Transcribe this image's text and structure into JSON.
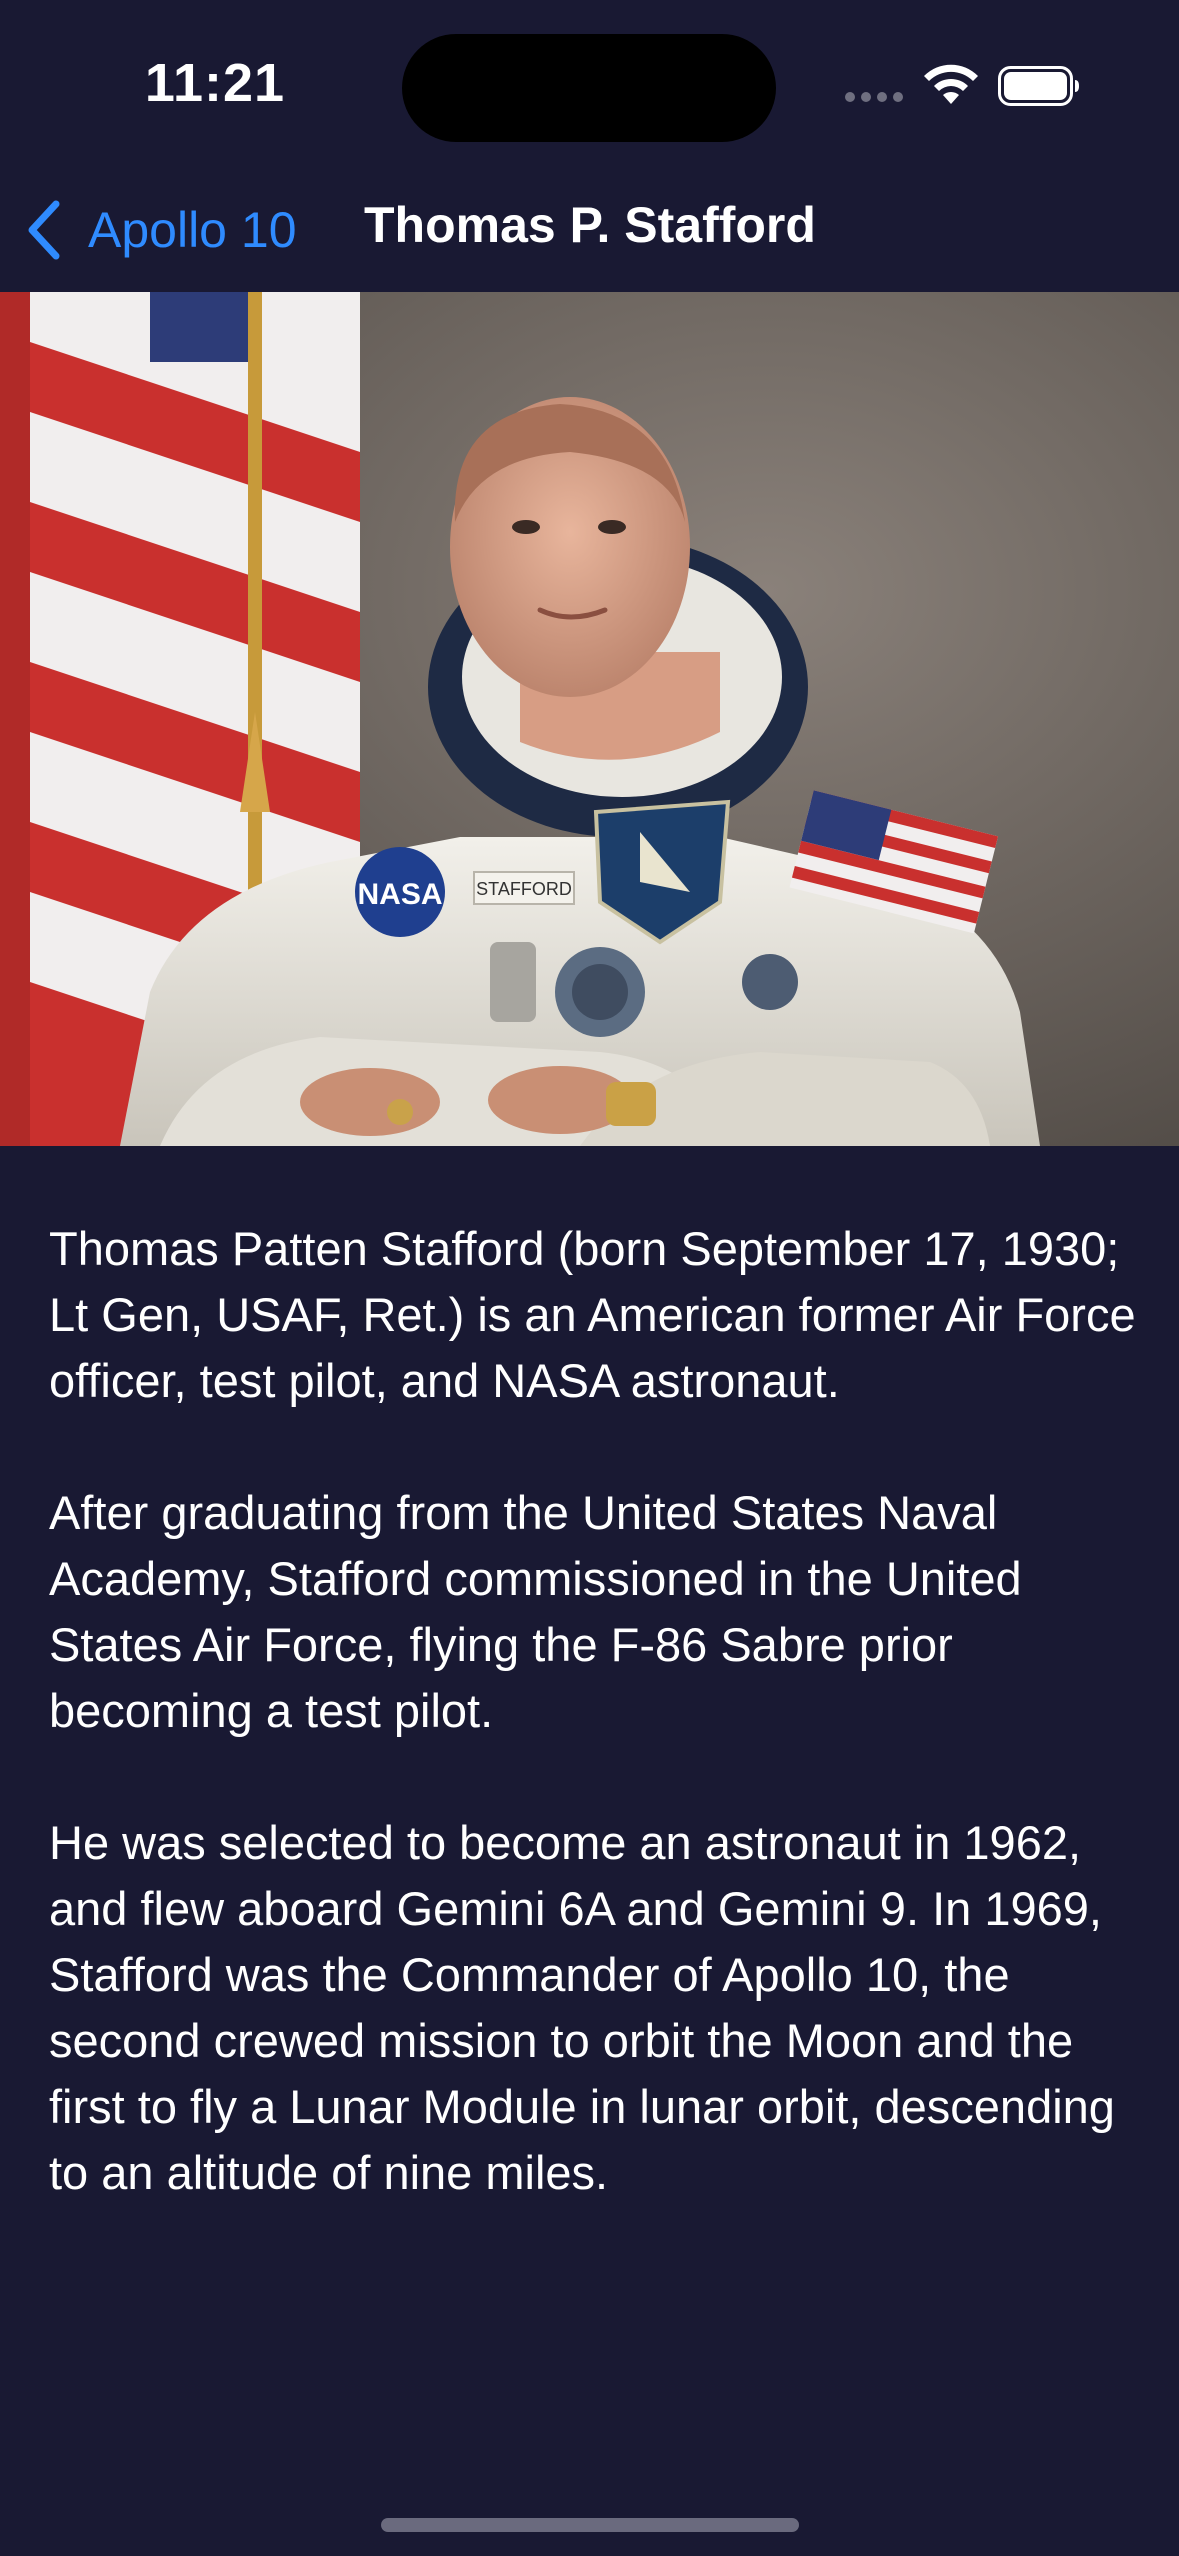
{
  "status_bar": {
    "time": "11:21",
    "icons": [
      "cellular-signal-icon",
      "wifi-icon",
      "battery-icon"
    ]
  },
  "nav": {
    "back_label": "Apollo 10",
    "back_icon": "chevron-left-icon",
    "title": "Thomas P. Stafford"
  },
  "portrait": {
    "alt": "Portrait photo"
  },
  "bio": {
    "paragraphs": [
      "Thomas Patten Stafford (born September 17, 1930; Lt Gen, USAF, Ret.) is an American former Air Force officer, test pilot, and NASA astronaut.",
      "After graduating from the United States Naval Academy, Stafford commissioned in the United States Air Force, flying the F-86 Sabre prior becoming a test pilot.",
      "He was selected to become an astronaut in 1962, and flew aboard Gemini 6A and Gemini 9. In 1969, Stafford was the Commander of Apollo 10, the second crewed mission to orbit the Moon and the first to fly a Lunar Module in lunar orbit, descending to an altitude of nine miles."
    ]
  },
  "colors": {
    "background": "#191933",
    "accent": "#2f8bff",
    "text": "#ffffff"
  }
}
